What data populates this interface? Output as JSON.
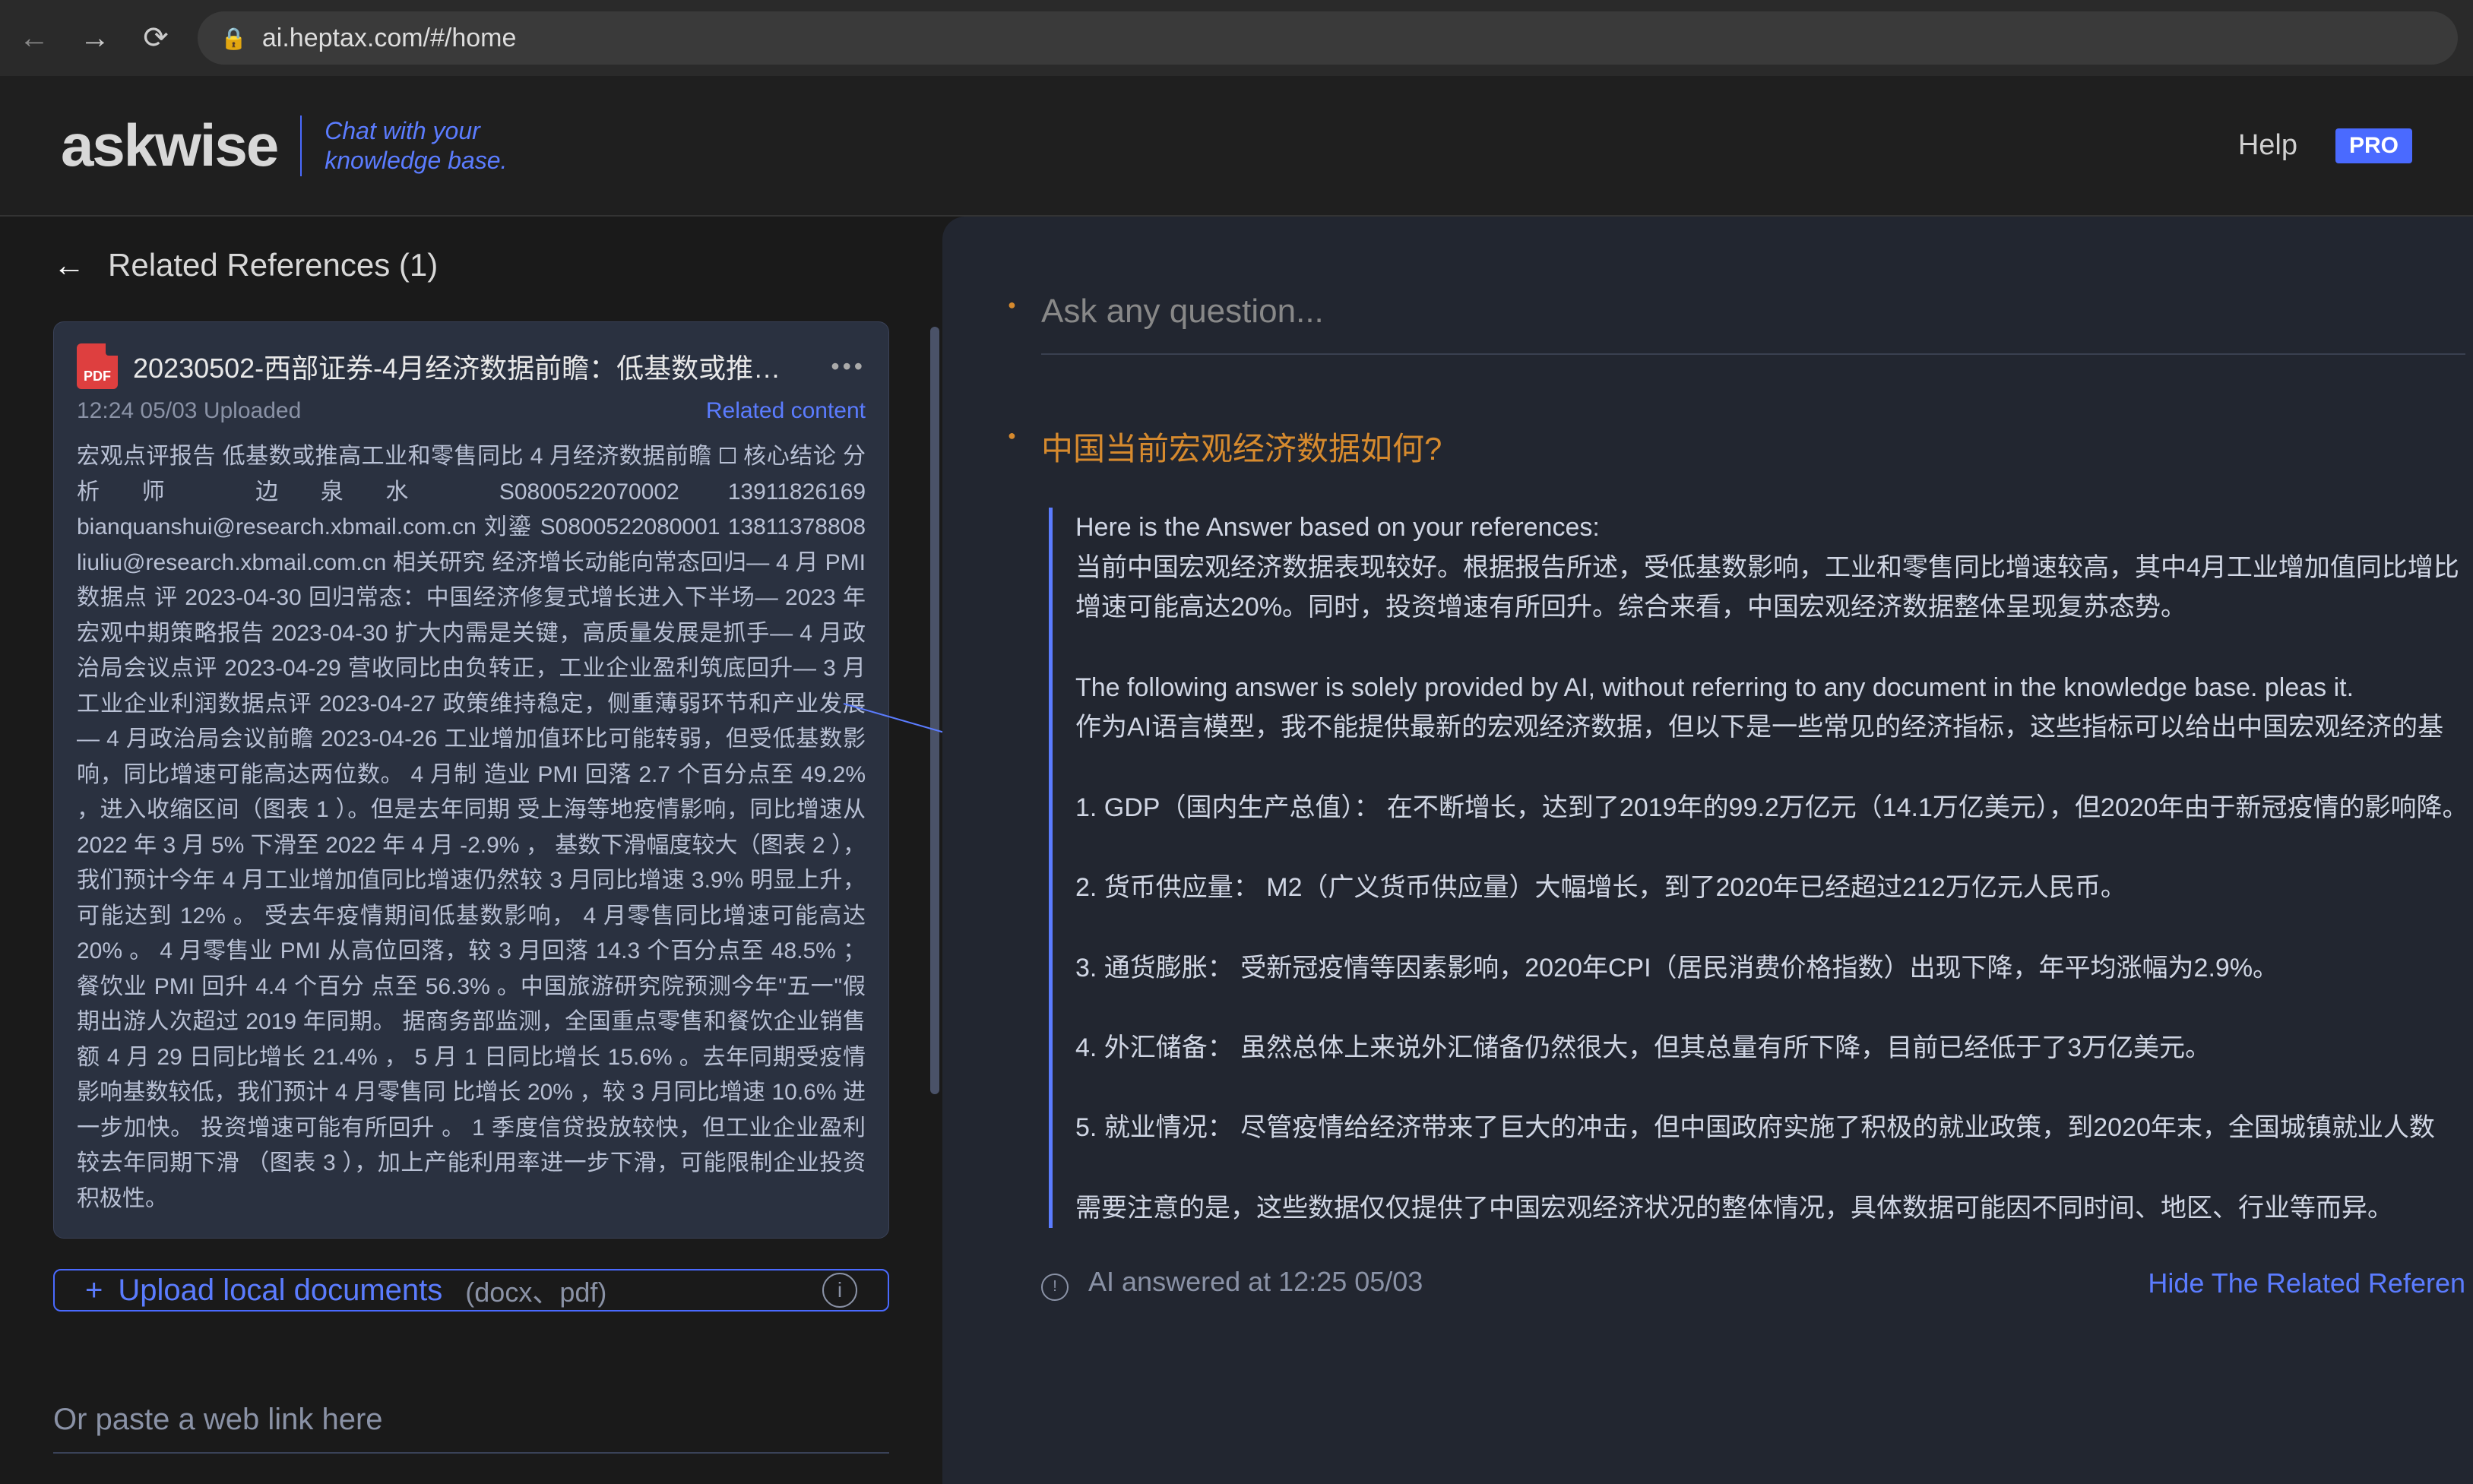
{
  "browser": {
    "url": "ai.heptax.com/#/home"
  },
  "header": {
    "logo": "askwise",
    "tagline_l1": "Chat with your",
    "tagline_l2": "knowledge base.",
    "help": "Help",
    "pro": "PRO"
  },
  "left": {
    "back_title": "Related References  (1)",
    "doc": {
      "pdf_label": "PDF",
      "title": "20230502-西部证券-4月经济数据前瞻：低基数或推…",
      "meta": "12:24 05/03 Uploaded",
      "related": "Related content",
      "body": "宏观点评报告 低基数或推高工业和零售同比 4 月经济数据前瞻 🞏 核心结论 分析师 边泉水 S0800522070002 13911826169 bianquanshui@research.xbmail.com.cn 刘鎏 S0800522080001 13811378808 liuliu@research.xbmail.com.cn 相关研究 经济增长动能向常态回归— 4 月 PMI 数据点 评 2023-04-30 回归常态：中国经济修复式增长进入下半场— 2023 年宏观中期策略报告 2023-04-30 扩大内需是关键，高质量发展是抓手— 4 月政 治局会议点评 2023-04-29 营收同比由负转正，工业企业盈利筑底回升— 3 月工业企业利润数据点评 2023-04-27 政策维持稳定，侧重薄弱环节和产业发展— 4 月政治局会议前瞻 2023-04-26 工业增加值环比可能转弱，但受低基数影响，同比增速可能高达两位数。 4 月制 造业 PMI 回落 2.7 个百分点至 49.2% ，进入收缩区间（图表 1 ）。但是去年同期 受上海等地疫情影响，同比增速从 2022 年 3 月 5% 下滑至 2022 年 4 月 -2.9% ， 基数下滑幅度较大（图表 2 ），我们预计今年 4 月工业增加值同比增速仍然较 3 月同比增速 3.9% 明显上升，可能达到 12% 。 受去年疫情期间低基数影响， 4 月零售同比增速可能高达 20% 。 4 月零售业 PMI 从高位回落，较 3 月回落 14.3 个百分点至 48.5% ；餐饮业 PMI 回升 4.4 个百分 点至 56.3% 。中国旅游研究院预测今年\"五一\"假期出游人次超过 2019 年同期。 据商务部监测，全国重点零售和餐饮企业销售额 4 月 29 日同比增长 21.4% ， 5 月 1 日同比增长 15.6% 。去年同期受疫情影响基数较低，我们预计 4 月零售同 比增长 20% ，较 3 月同比增速 10.6% 进一步加快。 投资增速可能有所回升 。 1 季度信贷投放较快，但工业企业盈利较去年同期下滑 （图表 3 ），加上产能利用率进一步下滑，可能限制企业投资积极性。"
    },
    "upload": {
      "label": "Upload local documents",
      "formats": "(docx、pdf)"
    },
    "weblink_placeholder": "Or paste a web link here"
  },
  "right": {
    "ask_placeholder": "Ask any question...",
    "question": "中国当前宏观经济数据如何?",
    "answer": "Here is the Answer based on your references:\n当前中国宏观经济数据表现较好。根据报告所述，受低基数影响，工业和零售同比增速较高，其中4月工业增加值同比增比增速可能高达20%。同时，投资增速有所回升。综合来看，中国宏观经济数据整体呈现复苏态势。\n\nThe following answer is solely provided by AI, without referring to any document in the knowledge base. pleas it.\n作为AI语言模型，我不能提供最新的宏观经济数据，但以下是一些常见的经济指标，这些指标可以给出中国宏观经济的基\n\n1. GDP（国内生产总值）： 在不断增长，达到了2019年的99.2万亿元（14.1万亿美元），但2020年由于新冠疫情的影响降。\n\n2. 货币供应量： M2（广义货币供应量）大幅增长，到了2020年已经超过212万亿元人民币。\n\n3. 通货膨胀： 受新冠疫情等因素影响，2020年CPI（居民消费价格指数）出现下降，年平均涨幅为2.9%。\n\n4. 外汇储备： 虽然总体上来说外汇储备仍然很大，但其总量有所下降，目前已经低于了3万亿美元。\n\n5. 就业情况： 尽管疫情给经济带来了巨大的冲击，但中国政府实施了积极的就业政策，到2020年末，全国城镇就业人数\n\n需要注意的是，这些数据仅仅提供了中国宏观经济状况的整体情况，具体数据可能因不同时间、地区、行业等而异。",
    "footer_time": "AI answered at 12:25 05/03",
    "hide_link": "Hide The Related Referen"
  }
}
